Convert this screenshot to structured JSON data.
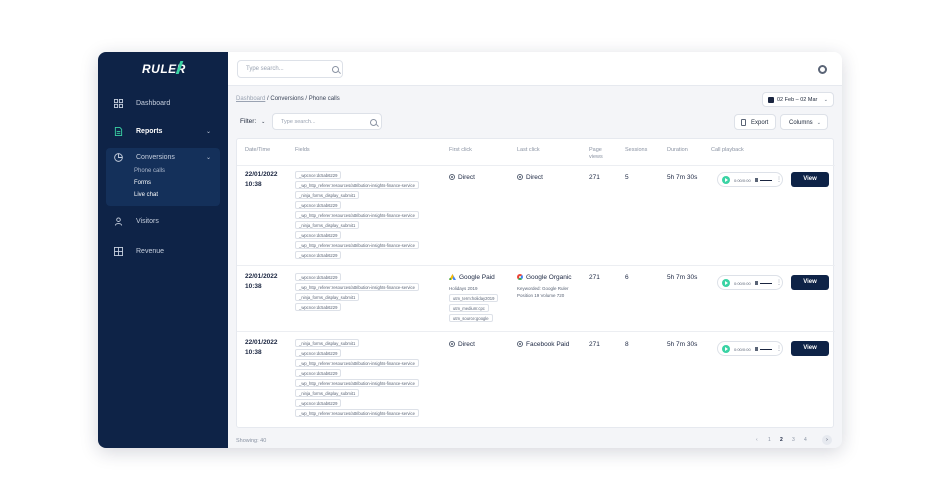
{
  "app": {
    "logo": "RULER"
  },
  "sidebar": {
    "items": [
      {
        "label": "Dashboard",
        "icon": "grid-icon"
      },
      {
        "label": "Reports",
        "icon": "document-icon"
      },
      {
        "label": "Conversions",
        "icon": "pie-chart-icon"
      },
      {
        "label": "Visitors",
        "icon": "user-icon"
      },
      {
        "label": "Revenue",
        "icon": "calculator-icon"
      }
    ],
    "conversions_sub": [
      "Phone calls",
      "Forms",
      "Live chat"
    ]
  },
  "topbar": {
    "search_placeholder": "Type search..."
  },
  "breadcrumb": {
    "root": "Dashboard",
    "path": " / Conversions / Phone calls"
  },
  "date_range": "02 Feb – 02 Mar",
  "toolbar": {
    "filter_label": "Filter:",
    "search_placeholder": "Type search...",
    "export_label": "Export",
    "columns_label": "Columns"
  },
  "table": {
    "headers": {
      "datetime": "Date/Time",
      "fields": "Fields",
      "first_click": "First click",
      "last_click": "Last click",
      "page_views": "Page views",
      "sessions": "Sessions",
      "duration": "Duration",
      "playback": "Call playback"
    },
    "rows": [
      {
        "date": "22/01/2022",
        "time": "10:38",
        "tags": [
          "_wpcnce:dc5ab6229",
          "_wp_http_referer:resources/attribution-insights-finance-service",
          "_ninja_forms_display_submit1",
          "_wpcnce:dc5ab6229",
          "_wp_http_referer:resources/attribution-insights-finance-service",
          "_ninja_forms_display_submit1",
          "_wpcnce:dc5ab6229",
          "_wp_http_referer:resources/attribution-insights-finance-service",
          "_wpcnce:dc5ab6229"
        ],
        "first_click": "Direct",
        "first_sub": [],
        "first_chips": [],
        "last_click": "Direct",
        "last_sub": [],
        "page_views": "271",
        "sessions": "5",
        "duration": "5h 7m 30s",
        "play_time": "0:00/0:00"
      },
      {
        "date": "22/01/2022",
        "time": "10:38",
        "tags": [
          "_wpcnce:dc5ab6229",
          "_wp_http_referer:resources/attribution-insights-finance-service",
          "_ninja_forms_display_submit1",
          "_wpcnce:dc5ab6229"
        ],
        "first_click": "Google Paid",
        "first_sub": [
          "Holidays 2019"
        ],
        "first_chips": [
          "utm_term:holiday2019",
          "utm_medium:cpc",
          "utm_source:google"
        ],
        "last_click": "Google Organic",
        "last_sub": [
          "Keyworded: Google Ruler",
          "Position 19 Volume 720"
        ],
        "page_views": "271",
        "sessions": "6",
        "duration": "5h 7m 30s",
        "play_time": "0:00/0:00"
      },
      {
        "date": "22/01/2022",
        "time": "10:38",
        "tags": [
          "_ninja_forms_display_submit1",
          "_wpcnce:dc5ab6229",
          "_wp_http_referer:resources/attribution-insights-finance-service",
          "_wpcnce:dc5ab6229",
          "_wp_http_referer:resources/attribution-insights-finance-service",
          "_ninja_forms_display_submit1",
          "_wpcnce:dc5ab6229",
          "_wp_http_referer:resources/attribution-insights-finance-service"
        ],
        "first_click": "Direct",
        "first_sub": [],
        "first_chips": [],
        "last_click": "Facebook Paid",
        "last_sub": [],
        "page_views": "271",
        "sessions": "8",
        "duration": "5h 7m 30s",
        "play_time": "0:00/0:00"
      }
    ],
    "view_label": "View"
  },
  "footer": {
    "showing": "Showing: 40",
    "pages": [
      "‹",
      "1",
      "2",
      "3",
      "4",
      "›"
    ]
  },
  "colors": {
    "sidebar": "#0e2347",
    "accent": "#3ad3a4",
    "view_button": "#0e2347"
  }
}
